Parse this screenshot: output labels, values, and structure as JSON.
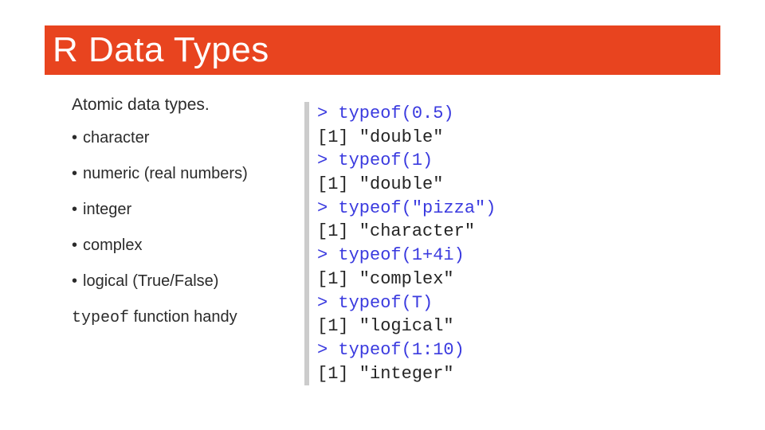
{
  "title": "R Data Types",
  "subtitle": "Atomic data types.",
  "bullets": [
    "character",
    "numeric (real numbers)",
    "integer",
    "complex",
    "logical (True/False)"
  ],
  "footnote": {
    "code": "typeof",
    "rest": " function handy"
  },
  "console": [
    {
      "kind": "in",
      "prompt": "> ",
      "text": "typeof(0.5)"
    },
    {
      "kind": "out",
      "text": "[1] \"double\""
    },
    {
      "kind": "in",
      "prompt": "> ",
      "text": "typeof(1)"
    },
    {
      "kind": "out",
      "text": "[1] \"double\""
    },
    {
      "kind": "in",
      "prompt": "> ",
      "text": "typeof(\"pizza\")"
    },
    {
      "kind": "out",
      "text": "[1] \"character\""
    },
    {
      "kind": "in",
      "prompt": "> ",
      "text": "typeof(1+4i)"
    },
    {
      "kind": "out",
      "text": "[1] \"complex\""
    },
    {
      "kind": "in",
      "prompt": "> ",
      "text": "typeof(T)"
    },
    {
      "kind": "out",
      "text": "[1] \"logical\""
    },
    {
      "kind": "in",
      "prompt": "> ",
      "text": "typeof(1:10)"
    },
    {
      "kind": "out",
      "text": "[1] \"integer\""
    }
  ]
}
